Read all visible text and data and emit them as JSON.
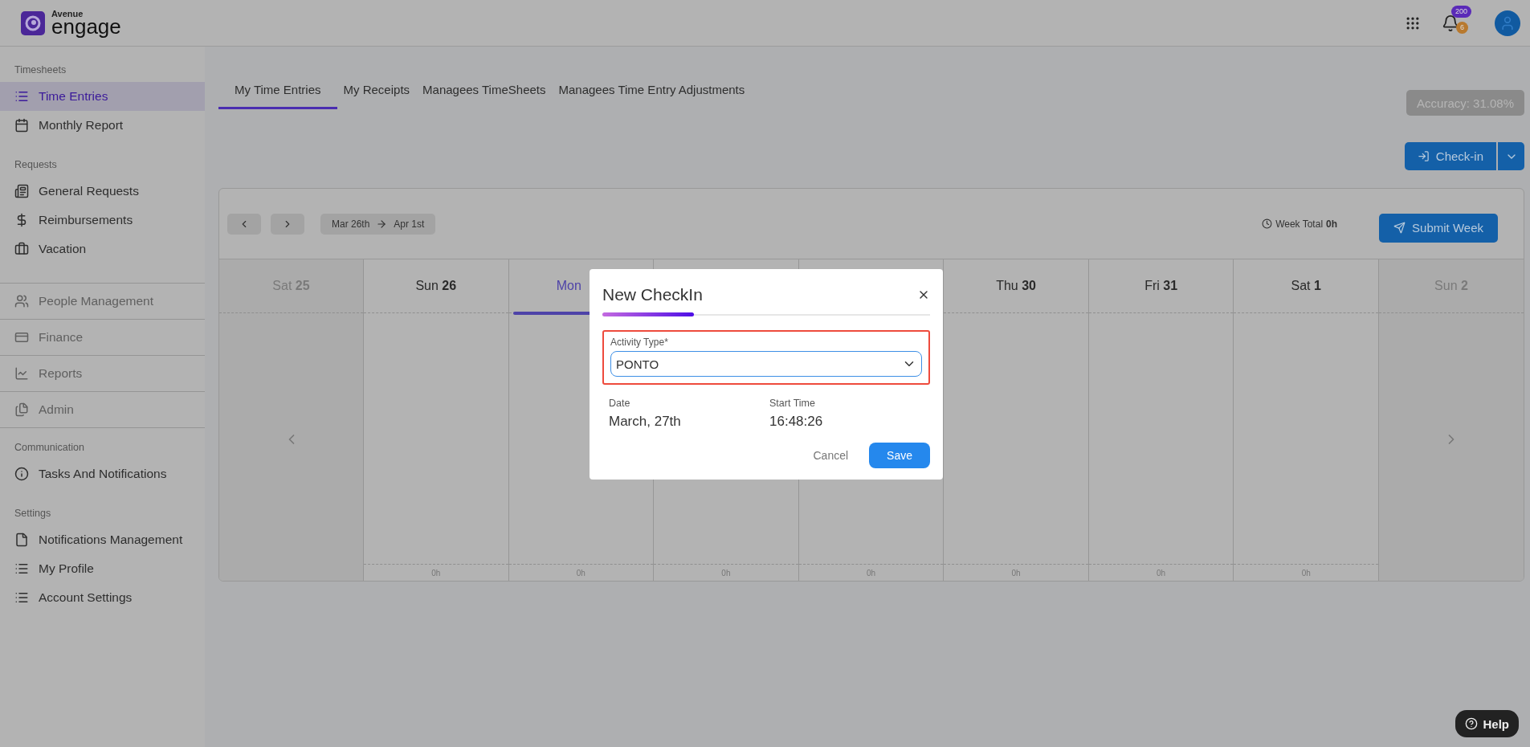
{
  "logo": {
    "top": "Avenue",
    "bottom": "engage"
  },
  "header": {
    "notification_count": "200",
    "alert_count": "6"
  },
  "sidebar": [
    {
      "kind": "section",
      "title": "Timesheets",
      "items": [
        {
          "label": "Time Entries",
          "selected": true
        },
        {
          "label": "Monthly Report",
          "selected": false
        }
      ]
    },
    {
      "kind": "section",
      "title": "Requests",
      "items": [
        {
          "label": "General Requests",
          "selected": false
        },
        {
          "label": "Reimbursements",
          "selected": false
        },
        {
          "label": "Vacation",
          "selected": false
        }
      ]
    },
    {
      "kind": "module",
      "label": "People Management"
    },
    {
      "kind": "module",
      "label": "Finance"
    },
    {
      "kind": "module",
      "label": "Reports"
    },
    {
      "kind": "module",
      "label": "Admin"
    },
    {
      "kind": "section",
      "title": "Communication",
      "items": [
        {
          "label": "Tasks And Notifications",
          "selected": false
        }
      ]
    },
    {
      "kind": "section",
      "title": "Settings",
      "items": [
        {
          "label": "Notifications Management",
          "selected": false
        },
        {
          "label": "My Profile",
          "selected": false
        },
        {
          "label": "Account Settings",
          "selected": false
        }
      ]
    }
  ],
  "tabs": [
    {
      "label": "My Time Entries",
      "selected": true
    },
    {
      "label": "My Receipts",
      "selected": false
    },
    {
      "label": "Managees TimeSheets",
      "selected": false
    },
    {
      "label": "Managees Time Entry Adjustments",
      "selected": false
    }
  ],
  "accuracy": "Accuracy: 31.08%",
  "check_in_button": "Check-in",
  "week": {
    "start": "Mar 26th",
    "end": "Apr 1st",
    "total_label": "Week Total",
    "total": "0h",
    "submit": "Submit Week"
  },
  "days": [
    {
      "kind": "outside",
      "weekday": "Sat",
      "day": "25"
    },
    {
      "kind": "week",
      "weekday": "Sun",
      "day": "26",
      "selected": false,
      "total": "0h"
    },
    {
      "kind": "week",
      "weekday": "Mon",
      "selected": true,
      "total": "0h"
    },
    {
      "kind": "week",
      "selected": false,
      "total": "0h"
    },
    {
      "kind": "week",
      "selected": false,
      "total": "0h"
    },
    {
      "kind": "week",
      "weekday": "Thu",
      "day": "30",
      "selected": false,
      "total": "0h"
    },
    {
      "kind": "week",
      "weekday": "Fri",
      "day": "31",
      "selected": false,
      "total": "0h"
    },
    {
      "kind": "week",
      "weekday": "Sat",
      "day": "1",
      "selected": false,
      "total": "0h"
    },
    {
      "kind": "outside",
      "weekday": "Sun",
      "day": "2"
    }
  ],
  "dialog": {
    "title": "New CheckIn",
    "field_label": "Activity Type*",
    "field_value": "PONTO",
    "invalid": true,
    "date_label": "Date",
    "date": "March, 27th",
    "time_label": "Start Time",
    "time": "16:48:26",
    "cancel": "Cancel",
    "save": "Save"
  },
  "help": "Help"
}
